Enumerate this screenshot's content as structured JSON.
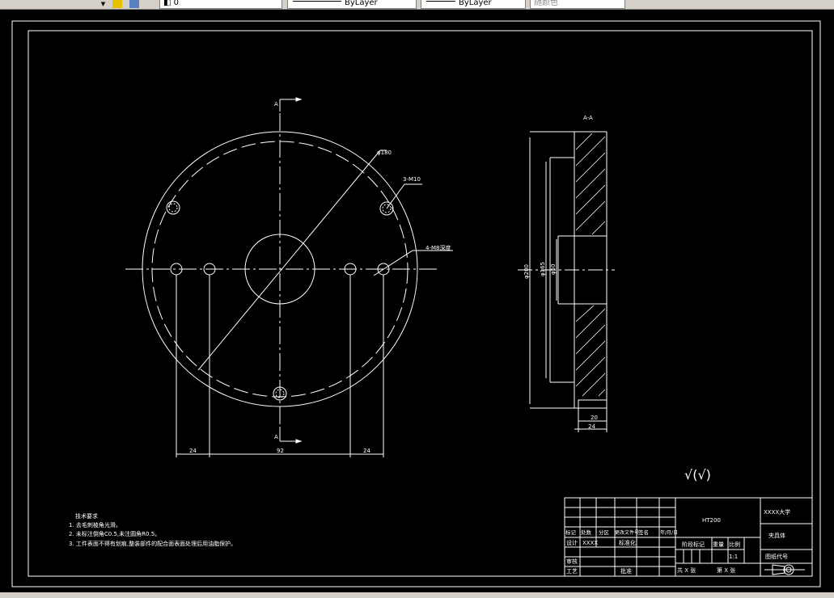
{
  "toolbar": {
    "layer_value": "0",
    "linetype_value": "ByLayer",
    "lineweight_value": "ByLayer",
    "color_value": "随颜色"
  },
  "drawing": {
    "dim_outer_diameter": "φ180",
    "dim_hole_callout_top": "3-M10",
    "dim_hole_callout_right": "4-M8深度",
    "dim_bottom_left": "24",
    "dim_bottom_mid": "92",
    "dim_bottom_right": "24",
    "section_label_top": "A",
    "section_label_bottom": "A",
    "section_title": "A-A",
    "section_dim_outer": "φ200",
    "section_dim_mid": "φ165",
    "section_dim_inner": "φ50",
    "section_dim_width_small": "20",
    "section_dim_width": "24",
    "surface_symbol": "√(√)"
  },
  "notes": {
    "heading": "技术要求",
    "line1": "1. 去毛刺棱角光滑。",
    "line2": "2. 未标注倒角C0.5,未注圆角R0.5。",
    "line3": "3. 工件表面不得有划痕,整装部件的配合面表面处理后用油脂保护。"
  },
  "title_block": {
    "material": "HT200",
    "school": "XXXX大学",
    "part_name": "夹具体",
    "drawing_no_label": "图纸代号",
    "scale_value": "1:1",
    "scale_label": "比例",
    "weight_label": "重量",
    "stage_label": "阶段标记",
    "sheet_total": "共 X 张",
    "sheet_no": "第 X 张",
    "designer_label": "设计",
    "designer_value": "XXXX",
    "standard_label": "标准化",
    "review_label": "审核",
    "process_label": "工艺",
    "approve_label": "批准",
    "mark_label": "标记",
    "count_label": "处数",
    "zone_label": "分区",
    "change_label": "更改文件号",
    "sign_label": "签名",
    "date_label": "年/月/日"
  }
}
